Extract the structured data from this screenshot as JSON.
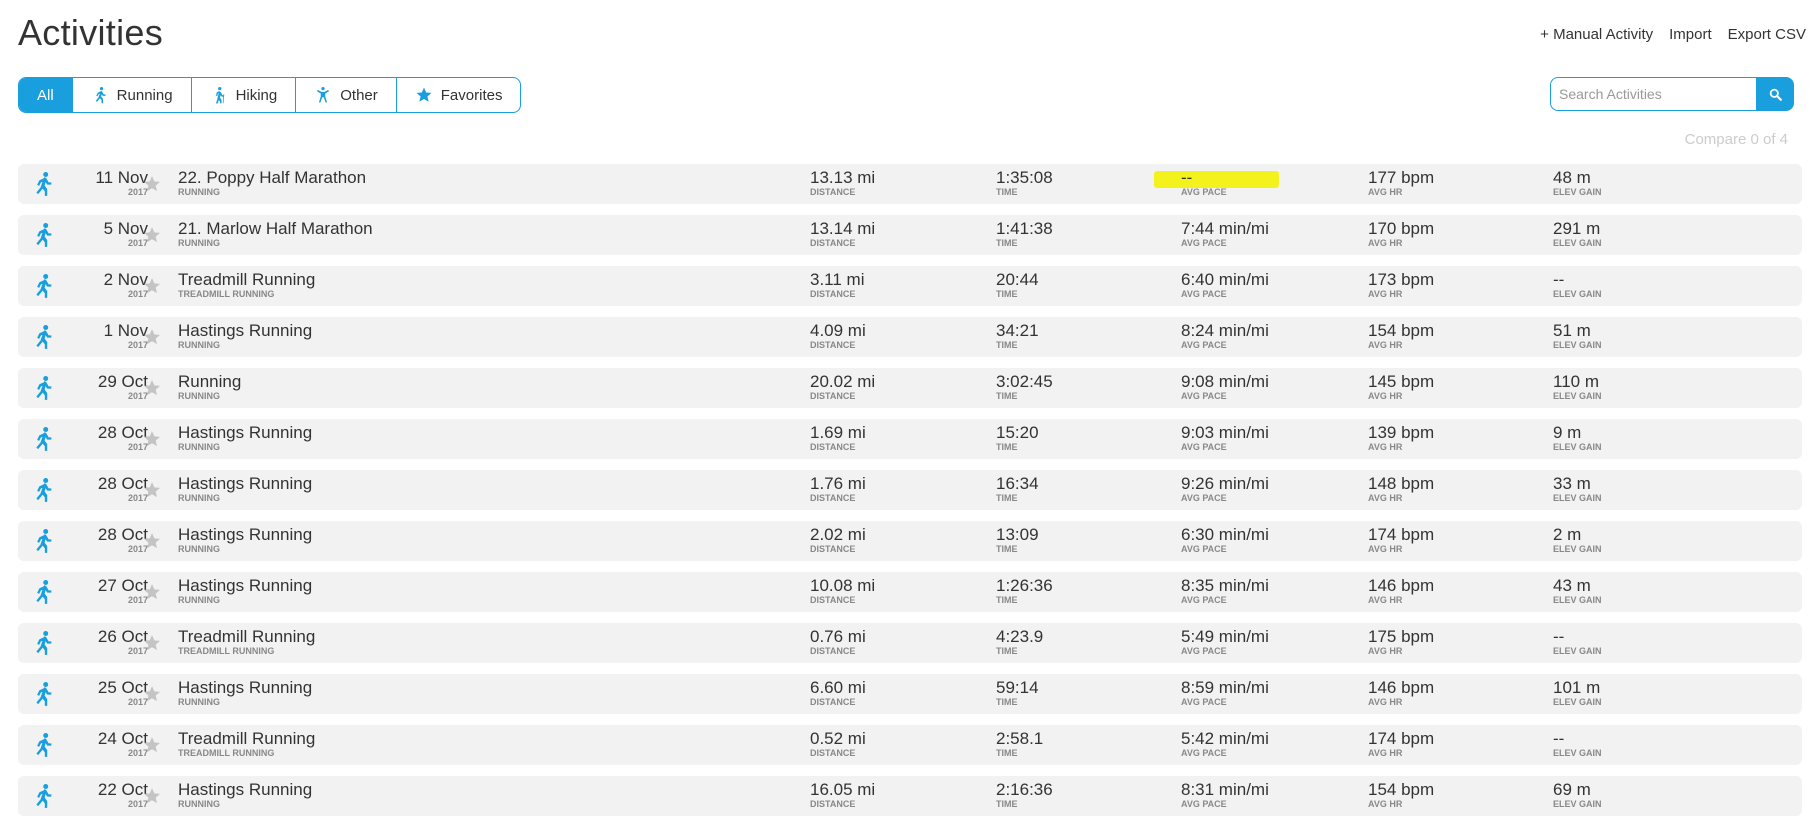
{
  "page_title": "Activities",
  "top_links": {
    "manual": "+ Manual Activity",
    "import": "Import",
    "export": "Export CSV"
  },
  "filters": [
    {
      "label": "All",
      "icon": "none",
      "active": true
    },
    {
      "label": "Running",
      "icon": "running-icon",
      "active": false
    },
    {
      "label": "Hiking",
      "icon": "hiking-icon",
      "active": false
    },
    {
      "label": "Other",
      "icon": "other-activity-icon",
      "active": false
    },
    {
      "label": "Favorites",
      "icon": "star-icon",
      "active": false
    }
  ],
  "search": {
    "placeholder": "Search Activities"
  },
  "compare": "Compare 0 of 4",
  "labels": {
    "distance": "DISTANCE",
    "time": "TIME",
    "pace": "AVG PACE",
    "hr": "AVG HR",
    "elev": "ELEV GAIN"
  },
  "activities": [
    {
      "day": "11 Nov",
      "year": "2017",
      "name": "22. Poppy Half Marathon",
      "type": "RUNNING",
      "distance": "13.13 mi",
      "time": "1:35:08",
      "pace": "--",
      "hr": "177 bpm",
      "elev": "48 m",
      "pace_highlighted": true
    },
    {
      "day": "5 Nov",
      "year": "2017",
      "name": "21. Marlow Half Marathon",
      "type": "RUNNING",
      "distance": "13.14 mi",
      "time": "1:41:38",
      "pace": "7:44 min/mi",
      "hr": "170 bpm",
      "elev": "291 m"
    },
    {
      "day": "2 Nov",
      "year": "2017",
      "name": "Treadmill Running",
      "type": "TREADMILL RUNNING",
      "distance": "3.11 mi",
      "time": "20:44",
      "pace": "6:40 min/mi",
      "hr": "173 bpm",
      "elev": "--"
    },
    {
      "day": "1 Nov",
      "year": "2017",
      "name": "Hastings Running",
      "type": "RUNNING",
      "distance": "4.09 mi",
      "time": "34:21",
      "pace": "8:24 min/mi",
      "hr": "154 bpm",
      "elev": "51 m"
    },
    {
      "day": "29 Oct",
      "year": "2017",
      "name": "Running",
      "type": "RUNNING",
      "distance": "20.02 mi",
      "time": "3:02:45",
      "pace": "9:08 min/mi",
      "hr": "145 bpm",
      "elev": "110 m"
    },
    {
      "day": "28 Oct",
      "year": "2017",
      "name": "Hastings Running",
      "type": "RUNNING",
      "distance": "1.69 mi",
      "time": "15:20",
      "pace": "9:03 min/mi",
      "hr": "139 bpm",
      "elev": "9 m"
    },
    {
      "day": "28 Oct",
      "year": "2017",
      "name": "Hastings Running",
      "type": "RUNNING",
      "distance": "1.76 mi",
      "time": "16:34",
      "pace": "9:26 min/mi",
      "hr": "148 bpm",
      "elev": "33 m"
    },
    {
      "day": "28 Oct",
      "year": "2017",
      "name": "Hastings Running",
      "type": "RUNNING",
      "distance": "2.02 mi",
      "time": "13:09",
      "pace": "6:30 min/mi",
      "hr": "174 bpm",
      "elev": "2 m"
    },
    {
      "day": "27 Oct",
      "year": "2017",
      "name": "Hastings Running",
      "type": "RUNNING",
      "distance": "10.08 mi",
      "time": "1:26:36",
      "pace": "8:35 min/mi",
      "hr": "146 bpm",
      "elev": "43 m"
    },
    {
      "day": "26 Oct",
      "year": "2017",
      "name": "Treadmill Running",
      "type": "TREADMILL RUNNING",
      "distance": "0.76 mi",
      "time": "4:23.9",
      "pace": "5:49 min/mi",
      "hr": "175 bpm",
      "elev": "--"
    },
    {
      "day": "25 Oct",
      "year": "2017",
      "name": "Hastings Running",
      "type": "RUNNING",
      "distance": "6.60 mi",
      "time": "59:14",
      "pace": "8:59 min/mi",
      "hr": "146 bpm",
      "elev": "101 m"
    },
    {
      "day": "24 Oct",
      "year": "2017",
      "name": "Treadmill Running",
      "type": "TREADMILL RUNNING",
      "distance": "0.52 mi",
      "time": "2:58.1",
      "pace": "5:42 min/mi",
      "hr": "174 bpm",
      "elev": "--"
    },
    {
      "day": "22 Oct",
      "year": "2017",
      "name": "Hastings Running",
      "type": "RUNNING",
      "distance": "16.05 mi",
      "time": "2:16:36",
      "pace": "8:31 min/mi",
      "hr": "154 bpm",
      "elev": "69 m"
    }
  ],
  "colors": {
    "accent": "#1a9fde",
    "row_bg": "#f2f2f2",
    "highlight": "#f3f21c"
  }
}
